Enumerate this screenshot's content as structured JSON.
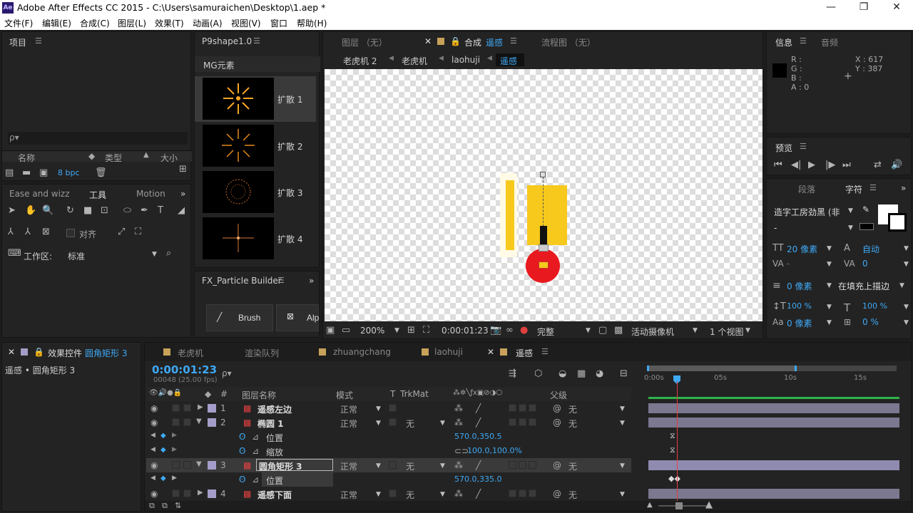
{
  "window": {
    "app_icon": "Ae",
    "title": "Adobe After Effects CC 2015 - C:\\Users\\samuraichen\\Desktop\\1.aep *",
    "minimize": "—",
    "maximize": "❐",
    "close": "✕"
  },
  "menu": [
    "文件(F)",
    "编辑(E)",
    "合成(C)",
    "图层(L)",
    "效果(T)",
    "动画(A)",
    "视图(V)",
    "窗口",
    "帮助(H)"
  ],
  "project_panel": {
    "title": "项目",
    "search_placeholder": "ρ▾",
    "col_name": "名称",
    "col_type": "类型",
    "col_size": "大小",
    "bpc": "8 bpc"
  },
  "p9_panel": {
    "title": "P9shape1.0",
    "category": "MG元素",
    "items": [
      "扩散 1",
      "扩散 2",
      "扩散 3",
      "扩散 4"
    ]
  },
  "fx_panel": {
    "title": "FX_Particle Builder",
    "brush": "Brush",
    "alp": "Alp"
  },
  "tools_panel": {
    "tab1": "Ease and wizz",
    "tab2": "工具",
    "tab3": "Motion",
    "align": "对齐",
    "workspace_label": "工作区:",
    "workspace_value": "标准"
  },
  "viewer": {
    "tab_layer": "图层 （无）",
    "tab_comp_prefix": "合成",
    "tab_comp_name": "遥感",
    "tab_flow": "流程图 （无）",
    "breadcrumbs": [
      "老虎机 2",
      "老虎机",
      "laohuji",
      "遥感"
    ],
    "zoom": "200%",
    "timecode": "0:00:01:23",
    "quality": "完整",
    "camera": "活动摄像机",
    "views": "1 个视图"
  },
  "info_panel": {
    "tab1": "信息",
    "tab2": "音频",
    "r": "R :",
    "g": "G :",
    "b": "B :",
    "a": "A : 0",
    "x": "X : 617",
    "y": "Y : 387"
  },
  "preview_panel": {
    "title": "预览"
  },
  "char_panel": {
    "tab1": "段落",
    "tab2": "字符",
    "font": "造字工房劲黑 (非",
    "style": "-",
    "size": "20 像素",
    "leading": "自动",
    "kerning": "-",
    "tracking": "0",
    "stroke_w": "0 像素",
    "stroke_type": "在填充上描边",
    "vscale": "100 %",
    "hscale": "100 %",
    "baseline": "0 像素",
    "tsume": "0 %"
  },
  "effects_panel": {
    "title_prefix": "效果控件",
    "title_layer": "圆角矩形 3",
    "subtitle": "遥感 • 圆角矩形 3"
  },
  "timeline": {
    "tabs": [
      "老虎机",
      "渲染队列",
      "zhuangchang",
      "laohuji",
      "遥感"
    ],
    "timecode": "0:00:01:23",
    "frames": "00048 (25.00 fps)",
    "col_num": "#",
    "col_name": "图层名称",
    "col_mode": "模式",
    "col_t": "T",
    "col_trk": "TrkMat",
    "col_parent": "父级",
    "ruler": [
      "0:00s",
      "05s",
      "10s",
      "15s"
    ],
    "layers": [
      {
        "num": "1",
        "name": "遥感左边",
        "mode": "正常",
        "trk": "",
        "parent": "无"
      },
      {
        "num": "2",
        "name": "椭圆 1",
        "mode": "正常",
        "trk": "无",
        "parent": "无"
      },
      {
        "num": "3",
        "name": "圆角矩形 3",
        "mode": "正常",
        "trk": "无",
        "parent": "无"
      },
      {
        "num": "4",
        "name": "遥感下面",
        "mode": "正常",
        "trk": "无",
        "parent": "无"
      }
    ],
    "props": [
      {
        "name": "位置",
        "value": "570.0,350.5"
      },
      {
        "name": "缩放",
        "value": "100.0,100.0%"
      },
      {
        "name": "位置",
        "value": "570.0,335.0"
      }
    ]
  },
  "colors": {
    "accent": "#3fa9f5",
    "bg": "#232323",
    "label": "#a49dc9",
    "playhead": "#e04040"
  }
}
